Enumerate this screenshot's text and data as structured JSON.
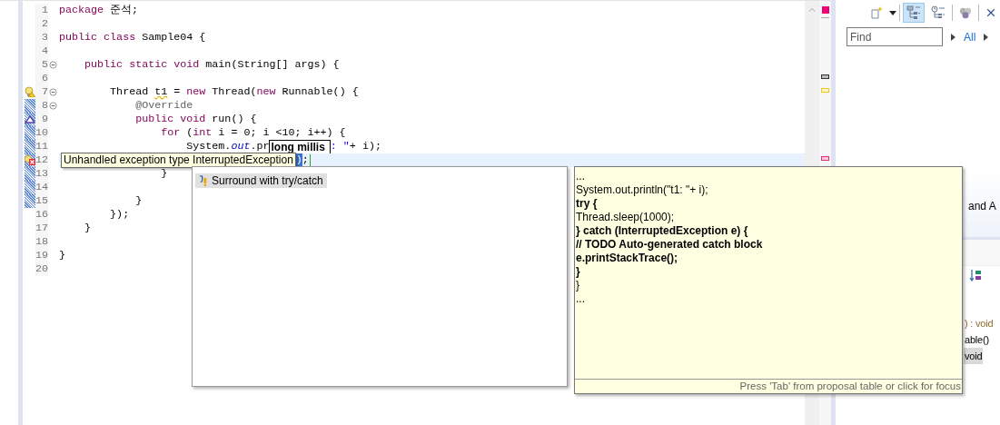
{
  "editor": {
    "lines": [
      {
        "number": "1",
        "foldable": false,
        "range": false,
        "current": false,
        "tokens": [
          {
            "kind": "kw",
            "text": "package"
          },
          {
            "kind": "plain",
            "text": " 준석;"
          }
        ]
      },
      {
        "number": "2",
        "foldable": false,
        "range": false,
        "current": false
      },
      {
        "number": "3",
        "foldable": false,
        "range": false,
        "current": false,
        "tokens": [
          {
            "kind": "kw",
            "text": "public class"
          },
          {
            "kind": "plain",
            "text": " Sample04 {"
          }
        ]
      },
      {
        "number": "4",
        "foldable": false,
        "range": false,
        "current": false
      },
      {
        "number": "5",
        "foldable": true,
        "range": false,
        "current": false,
        "tokens": [
          {
            "kind": "kw",
            "text": "    public static void"
          },
          {
            "kind": "plain",
            "text": " main(String[] args) {"
          }
        ]
      },
      {
        "number": "6",
        "foldable": false,
        "range": false,
        "current": false
      },
      {
        "number": "7",
        "foldable": true,
        "range": false,
        "current": false,
        "annotation": {
          "kind": "warning"
        },
        "tokens": [
          {
            "kind": "plain",
            "text": "        Thread "
          },
          {
            "kind": "warn",
            "text": "t1"
          },
          {
            "kind": "plain",
            "text": " = "
          },
          {
            "kind": "kw",
            "text": "new"
          },
          {
            "kind": "plain",
            "text": " Thread("
          },
          {
            "kind": "kw",
            "text": "new"
          },
          {
            "kind": "plain",
            "text": " Runnable() {"
          }
        ]
      },
      {
        "number": "8",
        "foldable": true,
        "range": true,
        "current": false,
        "tokens": [
          {
            "kind": "ann",
            "text": "            @Override"
          }
        ]
      },
      {
        "number": "9",
        "foldable": false,
        "range": true,
        "current": false,
        "annotation": {
          "kind": "override"
        },
        "tokens": [
          {
            "kind": "kw",
            "text": "            public void"
          },
          {
            "kind": "plain",
            "text": " run() {"
          }
        ]
      },
      {
        "number": "10",
        "foldable": false,
        "range": true,
        "current": false,
        "tokens": [
          {
            "kind": "kw",
            "text": "                for"
          },
          {
            "kind": "plain",
            "text": " ("
          },
          {
            "kind": "kw",
            "text": "int"
          },
          {
            "kind": "plain",
            "text": " i = 0; i <10; i++) {"
          }
        ]
      },
      {
        "number": "11",
        "foldable": false,
        "range": true,
        "current": false,
        "tokens": [
          {
            "kind": "plain",
            "text": "                    System."
          },
          {
            "kind": "field",
            "text": "out"
          },
          {
            "kind": "plain",
            "text": ".pr"
          },
          {
            "kind": "hint",
            "text": "long millis"
          },
          {
            "kind": "str",
            "text": ": \""
          },
          {
            "kind": "plain",
            "text": "+ i);"
          }
        ]
      },
      {
        "number": "12",
        "foldable": false,
        "range": true,
        "current": true,
        "annotation": {
          "kind": "error"
        },
        "tokens": [
          {
            "kind": "tooltip",
            "text": "Unhandled exception type InterruptedException"
          },
          {
            "kind": "sel",
            "text": ")"
          },
          {
            "kind": "plain",
            "text": ";"
          }
        ]
      },
      {
        "number": "13",
        "foldable": false,
        "range": true,
        "current": false,
        "tokens": [
          {
            "kind": "plain",
            "text": "                }"
          }
        ]
      },
      {
        "number": "14",
        "foldable": false,
        "range": true,
        "current": false
      },
      {
        "number": "15",
        "foldable": false,
        "range": true,
        "current": false,
        "tokens": [
          {
            "kind": "plain",
            "text": "            }"
          }
        ]
      },
      {
        "number": "16",
        "foldable": false,
        "range": false,
        "current": false,
        "tokens": [
          {
            "kind": "plain",
            "text": "        });"
          }
        ]
      },
      {
        "number": "17",
        "foldable": false,
        "range": false,
        "current": false,
        "tokens": [
          {
            "kind": "plain",
            "text": "    }"
          }
        ]
      },
      {
        "number": "18",
        "foldable": false,
        "range": false,
        "current": false
      },
      {
        "number": "19",
        "foldable": false,
        "range": false,
        "current": false,
        "tokens": [
          {
            "kind": "plain",
            "text": "}"
          }
        ]
      },
      {
        "number": "20",
        "foldable": false,
        "range": false,
        "current": false
      }
    ]
  },
  "overview_ruler": {
    "status": {
      "kind": "error"
    },
    "marks": [
      {
        "kind": "occurrence"
      },
      {
        "kind": "warning"
      },
      {
        "kind": "error"
      }
    ]
  },
  "proposals": [
    {
      "label": "Surround with try/catch",
      "selected": true
    }
  ],
  "proposal_info": {
    "lines": [
      {
        "text": "...",
        "bold": false
      },
      {
        "text": "System.out.println(\"t1: \"+ i);",
        "bold": false
      },
      {
        "text": "try {",
        "bold": true
      },
      {
        "text": "Thread.sleep(1000);",
        "bold": false
      },
      {
        "text": "} catch (InterruptedException e) {",
        "bold": true
      },
      {
        "text": "// TODO Auto-generated catch block",
        "bold": true
      },
      {
        "text": "e.printStackTrace();",
        "bold": true
      },
      {
        "text": "}",
        "bold": true
      },
      {
        "text": "}",
        "bold": false
      },
      {
        "text": "...",
        "bold": false
      }
    ],
    "footer": "Press 'Tab' from proposal table or click for focus"
  },
  "outline": {
    "toolbar": [
      {
        "kind": "new",
        "selected": false
      },
      {
        "kind": "hierarchy",
        "selected": true
      },
      {
        "kind": "clock-hierarchy",
        "selected": false
      },
      {
        "kind": "gem",
        "selected": false
      },
      {
        "kind": "close",
        "selected": false
      }
    ],
    "find": {
      "placeholder": "Find"
    },
    "filter": "All",
    "heading_fragment": "and A",
    "items": [
      {
        "text": ") : void",
        "kind": "signature",
        "selected": false
      },
      {
        "text": "able()",
        "kind": "code",
        "selected": false
      },
      {
        "text": "void",
        "kind": "code",
        "selected": true
      }
    ]
  }
}
